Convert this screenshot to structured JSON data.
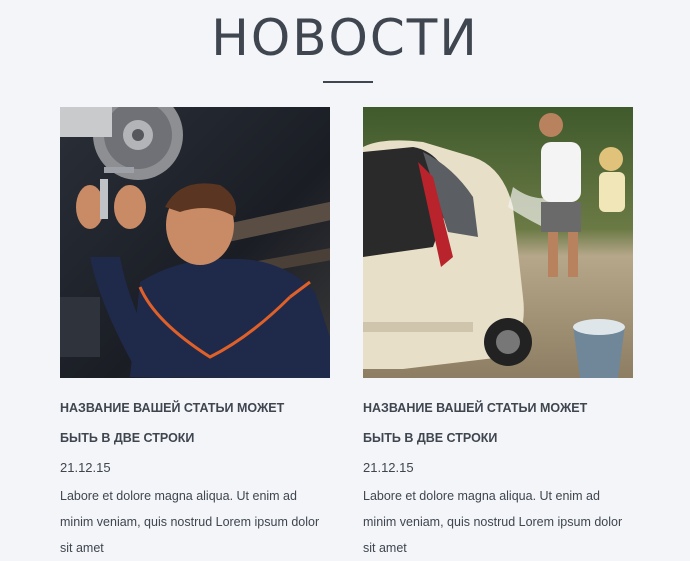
{
  "section": {
    "title": "НОВОСТИ"
  },
  "news": [
    {
      "image": "mechanic-repairing-car-photo",
      "title": "НАЗВАНИЕ ВАШЕЙ СТАТЬИ МОЖЕТ БЫТЬ В ДВЕ СТРОКИ",
      "date": "21.12.15",
      "excerpt": "Labore et dolore magna aliqua. Ut enim ad minim veniam, quis nostrud Lorem ipsum dolor sit amet"
    },
    {
      "image": "washing-car-photo",
      "title": "НАЗВАНИЕ ВАШЕЙ СТАТЬИ МОЖЕТ БЫТЬ В ДВЕ СТРОКИ",
      "date": "21.12.15",
      "excerpt": "Labore et dolore magna aliqua. Ut enim ad minim veniam, quis nostrud Lorem ipsum dolor sit amet"
    }
  ],
  "colors": {
    "background": "#f4f5f8",
    "text": "#3f4650"
  }
}
